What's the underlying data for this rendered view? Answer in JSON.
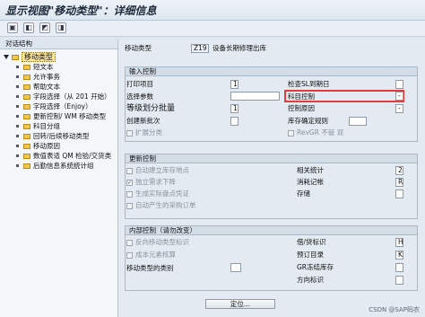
{
  "window": {
    "title": "显示视图\"移动类型\"：详细信息"
  },
  "toolbar": {
    "icons": [
      "save-icon",
      "back-icon",
      "prev-icon",
      "next-icon"
    ]
  },
  "tree": {
    "header": "对话结构",
    "root": "移动类型",
    "items": [
      "短文本",
      "允许事务",
      "帮助文本",
      "字段选择（从 201 开始）",
      "字段选择（Enjoy）",
      "更新控制/ WM 移动类型",
      "科目分组",
      "回转/后续移动类型",
      "移动原因",
      "数值表适 QM 检验/交货类",
      "后勤信息系统统计组"
    ]
  },
  "header": {
    "movement_type_label": "移动类型",
    "movement_type_value": "Z19",
    "movement_type_desc": "设备长期修理出库"
  },
  "entry_control": {
    "title": "输入控制",
    "print_label": "打印项目",
    "print_value": "1",
    "sl_check_label": "检查SL到期日",
    "sl_check_value": "",
    "param_label": "选择参数",
    "param_value": "",
    "account_ctrl_label": "科目控制",
    "account_ctrl_value": "-",
    "level_label": "等级划分批量",
    "level_value": "1",
    "reason_ctrl_label": "控制原因",
    "reason_ctrl_value": "-",
    "create_batch_label": "创建新批次",
    "inv_rule_label": "库存确定规则",
    "inv_rule_value": "",
    "ext_class_label": "扩展分类",
    "revgr_label": "RevGR 不管 双"
  },
  "update_control": {
    "title": "更新控制",
    "auto_po_label": "自动建立库存地点",
    "related_stat_label": "相关统计",
    "related_stat_value": "2",
    "reduce_req_label": "独立需求下降",
    "consumption_label": "消耗记帐",
    "consumption_value": "R",
    "gen_phys_label": "生成实际盘点凭证",
    "stock_label": "存储",
    "stock_value": "",
    "auto_po2_label": "自动产生的采购订单"
  },
  "internal_control": {
    "title": "内部控制（请勿改变）",
    "reverse_label": "反向移动类型标识",
    "debit_credit_label": "借/贷标识",
    "debit_credit_value": "H",
    "cost_element_label": "成本元素核算",
    "planned_label": "预订目录",
    "planned_value": "K",
    "category_label": "移动类型的类别",
    "category_value": "",
    "gr_blocked_label": "GR冻结库存",
    "gr_blocked_value": "",
    "direction_label": "方向标识",
    "direction_value": ""
  },
  "footer": {
    "position_button": "定位...",
    "watermark": "CSDN @SAP码农"
  }
}
